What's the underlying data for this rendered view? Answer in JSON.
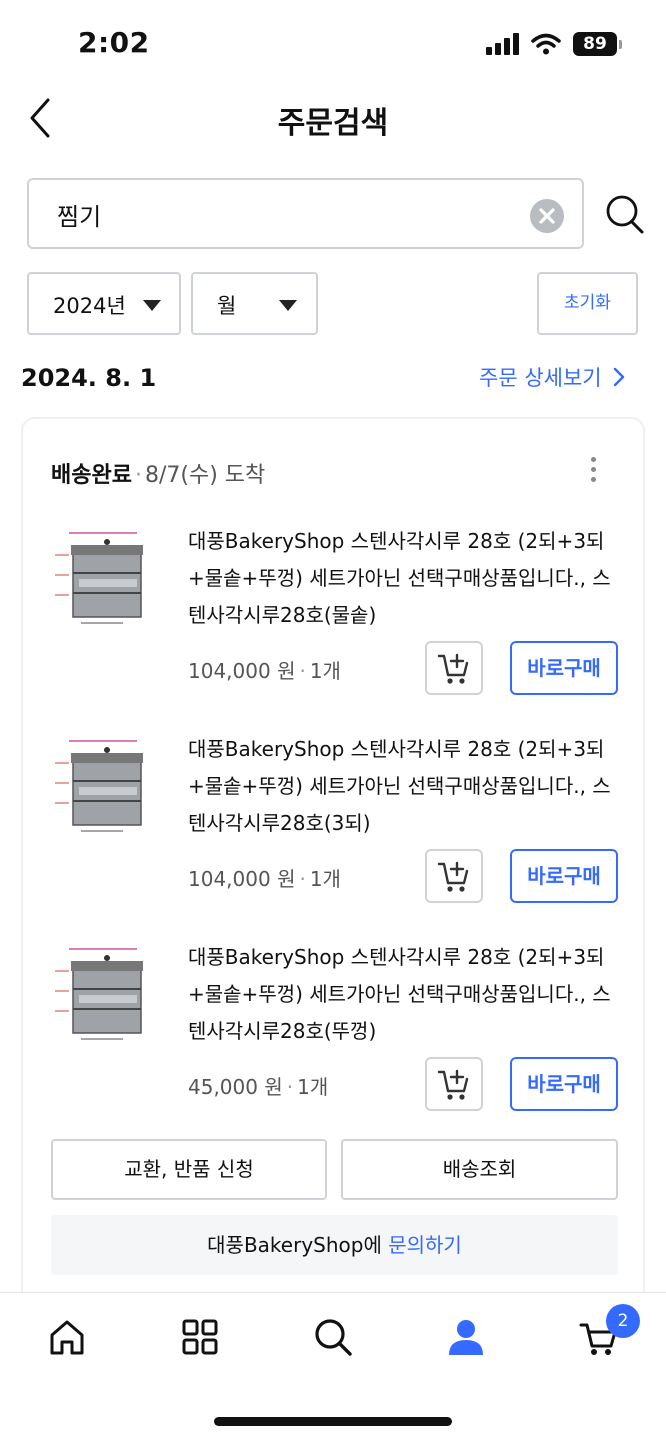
{
  "status_bar": {
    "time": "2:02",
    "battery": "89"
  },
  "header": {
    "title": "주문검색"
  },
  "search": {
    "value": "찜기",
    "placeholder": ""
  },
  "filters": {
    "year": "2024년",
    "month": "월",
    "reset": "초기화"
  },
  "order": {
    "date": "2024. 8. 1",
    "detail_link": "주문 상세보기",
    "status": "배송완료",
    "eta": "8/7(수) 도착",
    "items": [
      {
        "name": "대풍BakeryShop 스텐사각시루 28호 (2되+3되+물솥+뚜껑) 세트가아닌 선택구매상품입니다., 스텐사각시루28호(물솥)",
        "price": "104,000 원",
        "qty": "1개",
        "buy_label": "바로구매"
      },
      {
        "name": "대풍BakeryShop 스텐사각시루 28호 (2되+3되+물솥+뚜껑) 세트가아닌 선택구매상품입니다., 스텐사각시루28호(3되)",
        "price": "104,000 원",
        "qty": "1개",
        "buy_label": "바로구매"
      },
      {
        "name": "대풍BakeryShop 스텐사각시루 28호 (2되+3되+물솥+뚜껑) 세트가아닌 선택구매상품입니다., 스텐사각시루28호(뚜껑)",
        "price": "45,000 원",
        "qty": "1개",
        "buy_label": "바로구매"
      }
    ],
    "exchange_label": "교환, 반품 신청",
    "tracking_label": "배송조회",
    "inquiry_text": "대풍BakeryShop에 ",
    "inquiry_link": "문의하기"
  },
  "tab_bar": {
    "items": [
      "home-icon",
      "category-grid-icon",
      "search-icon",
      "my-account-icon",
      "cart-icon"
    ],
    "cart_count": "2"
  },
  "colors": {
    "accent": "#346aff",
    "border": "#cfd3d8",
    "text": "#111111",
    "muted": "#555555"
  }
}
